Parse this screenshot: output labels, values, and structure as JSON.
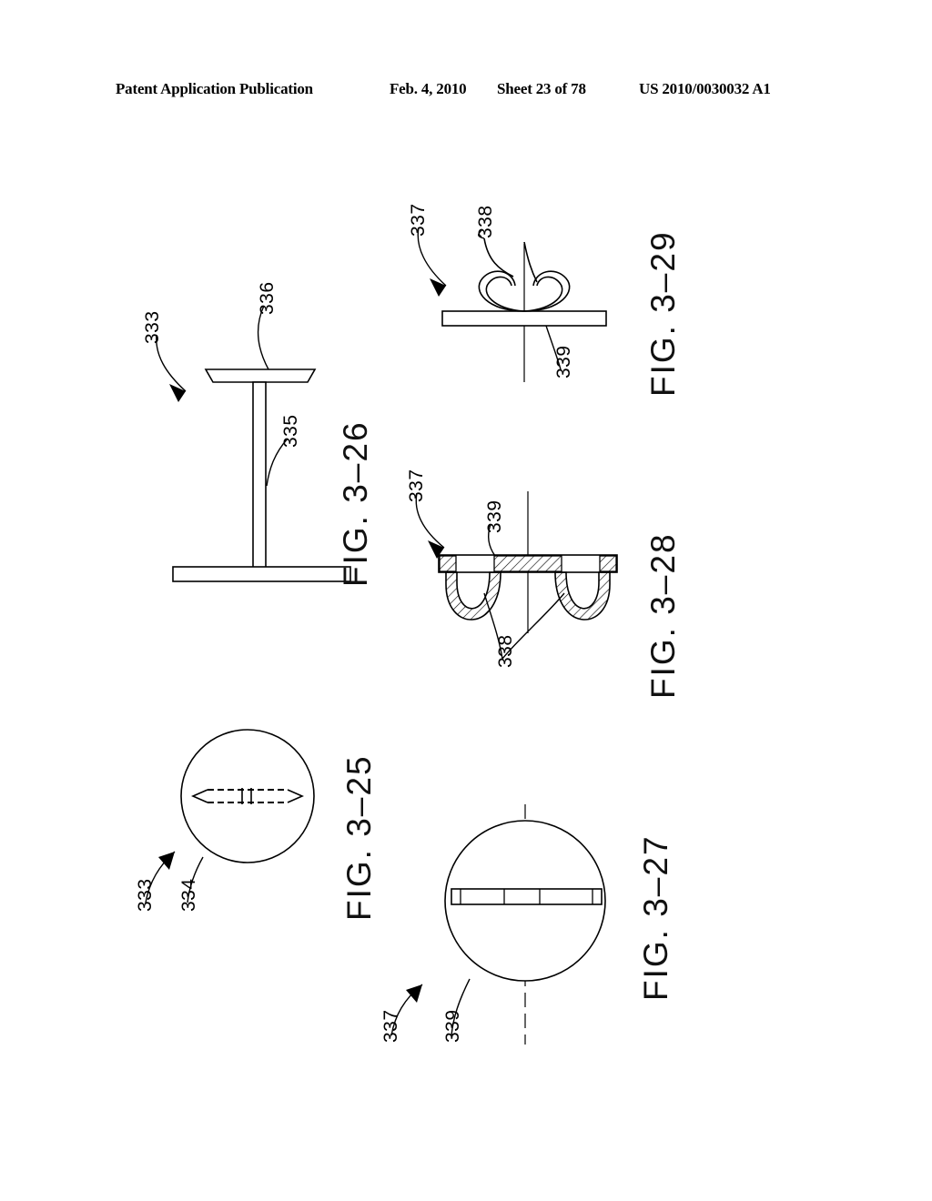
{
  "header": {
    "publication": "Patent Application Publication",
    "date": "Feb. 4, 2010",
    "sheet": "Sheet 23 of 78",
    "patent_number": "US 2010/0030032 A1"
  },
  "figures": [
    {
      "id": "fig-3-26",
      "caption": "FIG. 3–26",
      "description": "Side elevation of a pedestal: flat base, vertical stem, tapered top plate",
      "reference_numbers": [
        {
          "label": "333",
          "kind": "assembly-arrow"
        },
        {
          "label": "336",
          "kind": "leader"
        },
        {
          "label": "335",
          "kind": "leader"
        }
      ]
    },
    {
      "id": "fig-3-25",
      "caption": "FIG. 3–25",
      "description": "Plan view: circular disc with hidden elongated slot shown in dashed lines",
      "reference_numbers": [
        {
          "label": "333",
          "kind": "assembly-arrow"
        },
        {
          "label": "334",
          "kind": "leader"
        }
      ]
    },
    {
      "id": "fig-3-29",
      "caption": "FIG. 3–29",
      "description": "Side elevation: flat bar with paired curved hook elements on top",
      "reference_numbers": [
        {
          "label": "337",
          "kind": "assembly-arrow"
        },
        {
          "label": "338",
          "kind": "leader"
        },
        {
          "label": "339",
          "kind": "leader"
        }
      ]
    },
    {
      "id": "fig-3-28",
      "caption": "FIG. 3–28",
      "description": "Hatched cross-section: flat bar with two loop elements depending below",
      "reference_numbers": [
        {
          "label": "337",
          "kind": "assembly-arrow"
        },
        {
          "label": "339",
          "kind": "leader"
        },
        {
          "label": "338",
          "kind": "leader"
        }
      ]
    },
    {
      "id": "fig-3-27",
      "caption": "FIG. 3–27",
      "description": "Plan view: circular disc with segmented horizontal bar across the diameter",
      "reference_numbers": [
        {
          "label": "337",
          "kind": "assembly-arrow"
        },
        {
          "label": "339",
          "kind": "leader"
        }
      ]
    }
  ],
  "labels": {
    "f326_333": "333",
    "f326_336": "336",
    "f326_335": "335",
    "f326_caption": "FIG. 3–26",
    "f325_333": "333",
    "f325_334": "334",
    "f325_caption": "FIG. 3–25",
    "f329_337": "337",
    "f329_338": "338",
    "f329_339": "339",
    "f329_caption": "FIG. 3–29",
    "f328_337": "337",
    "f328_339": "339",
    "f328_338": "338",
    "f328_caption": "FIG. 3–28",
    "f327_337": "337",
    "f327_339": "339",
    "f327_caption": "FIG. 3–27"
  },
  "colors": {
    "ink": "#000000",
    "paper": "#ffffff"
  }
}
